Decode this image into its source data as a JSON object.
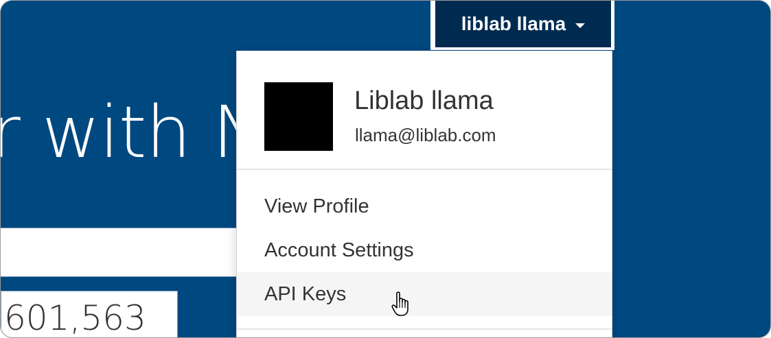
{
  "hero": {
    "partial_heading": "r with Nu"
  },
  "stats": {
    "visible_count": "601,563"
  },
  "user_menu": {
    "toggle_label": "liblab llama",
    "profile": {
      "name": "Liblab llama",
      "email": "llama@liblab.com"
    },
    "items": [
      {
        "label": "View Profile"
      },
      {
        "label": "Account Settings"
      },
      {
        "label": "API Keys",
        "hovered": true
      }
    ]
  },
  "colors": {
    "page_background": "#004880",
    "toggle_background": "#002b50",
    "hover_background": "#f5f5f5",
    "text": "#333333"
  },
  "icons": {
    "caret": "caret-down-icon",
    "cursor": "hand-pointer-cursor-icon"
  }
}
